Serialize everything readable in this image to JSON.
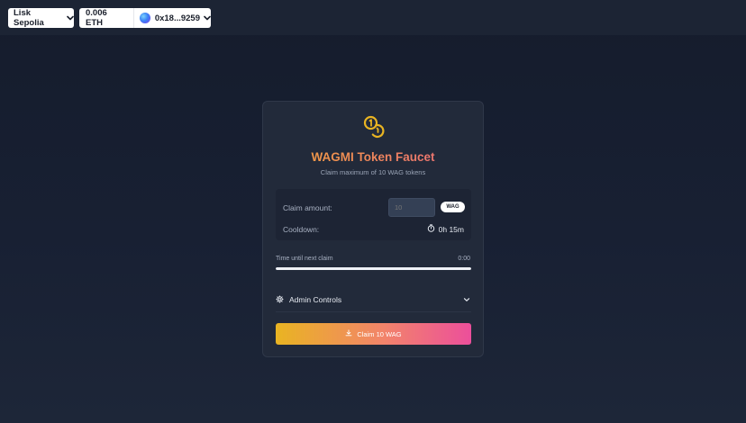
{
  "network": {
    "label": "Lisk Sepolia",
    "icon": "chevron-down-icon"
  },
  "wallet": {
    "balance": "0.006 ETH",
    "address": "0x18...9259",
    "avatar_icon": "wallet-avatar-icon",
    "icon": "chevron-down-icon"
  },
  "faucet": {
    "logo_icon": "coins-icon",
    "title": "WAGMI Token Faucet",
    "subtitle": "Claim maximum of 10 WAG tokens",
    "claim_amount_label": "Claim amount:",
    "claim_amount_placeholder": "10",
    "token_badge": "WAG",
    "cooldown_label": "Cooldown:",
    "cooldown_value": "0h 15m",
    "cooldown_icon": "timer-icon",
    "progress_label": "Time until next claim",
    "progress_time": "0:00",
    "progress_fraction": 1.0,
    "admin_label": "Admin Controls",
    "admin_icon": "gear-icon",
    "claim_button_label": "Claim 10 WAG",
    "claim_button_icon": "download-icon"
  },
  "colors": {
    "accent_gold": "#e9b422",
    "accent_pink": "#ec4f9b",
    "title_orange": "#f2a33a",
    "background": "#182033",
    "card": "#222a3a"
  }
}
